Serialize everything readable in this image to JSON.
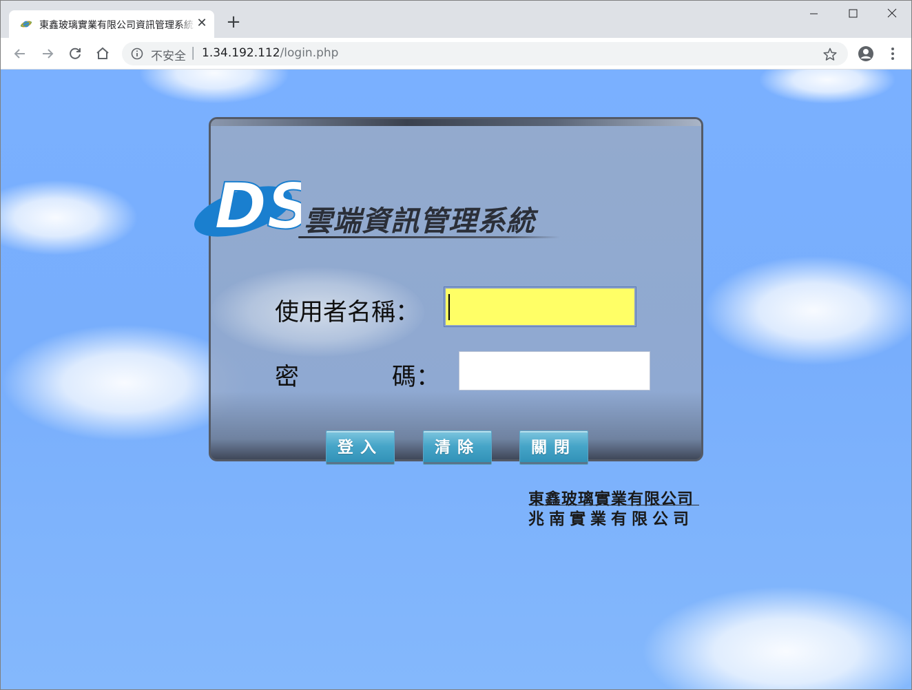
{
  "browser": {
    "tab_title": "東鑫玻璃實業有限公司資訊管理系統",
    "tab_close": "✕",
    "new_tab": "+",
    "window_buttons": [
      "minimize-icon",
      "maximize-icon",
      "close-icon"
    ],
    "security_label": "不安全",
    "url_separator": "|",
    "url_host": "1.34.192.112",
    "url_path": "/login.php",
    "icons": [
      "back-icon",
      "forward-icon",
      "reload-icon",
      "home-icon",
      "info-icon",
      "star-icon",
      "profile-icon",
      "menu-icon"
    ]
  },
  "page": {
    "logo_text": "DS",
    "system_title": "雲端資訊管理系統",
    "username_label": "使用者名稱：",
    "password_label_a": "密",
    "password_label_b": "碼：",
    "username_value": "",
    "password_value": "",
    "buttons": {
      "login": "登入",
      "clear": "清除",
      "close": "關閉"
    },
    "companies": [
      "東鑫玻璃實業有限公司",
      "兆南實業有限公司"
    ],
    "colors": {
      "sky": "#7ab0ff",
      "username_field_bg": "#ffff66",
      "button": "#46a5c8",
      "logo_blue": "#1a7fcf"
    }
  }
}
